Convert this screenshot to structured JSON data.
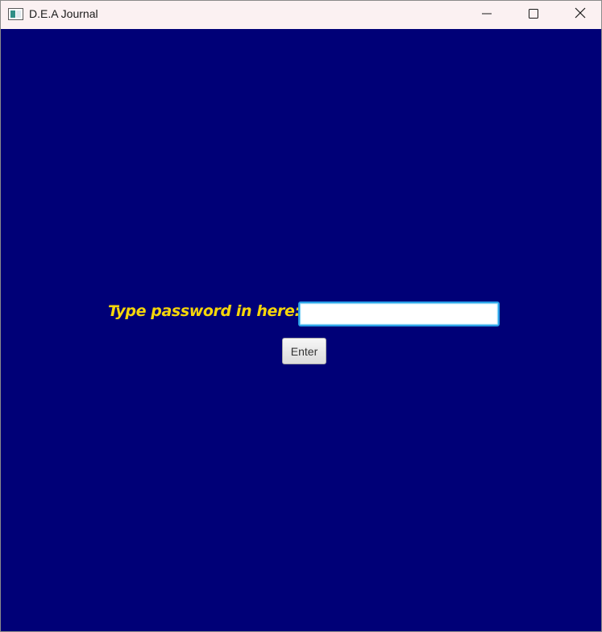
{
  "window": {
    "title": "D.E.A Journal",
    "app_icon": "window-app-icon",
    "controls": {
      "minimize_icon": "minimize-icon",
      "maximize_icon": "maximize-icon",
      "close_icon": "close-icon"
    }
  },
  "login": {
    "prompt_label": "Type password in here:",
    "password_value": "",
    "enter_label": "Enter"
  },
  "colors": {
    "background": "#000077",
    "prompt_text": "#f5d60a",
    "titlebar": "#fbf1f2",
    "input_focus_border": "#2aa0e6"
  }
}
